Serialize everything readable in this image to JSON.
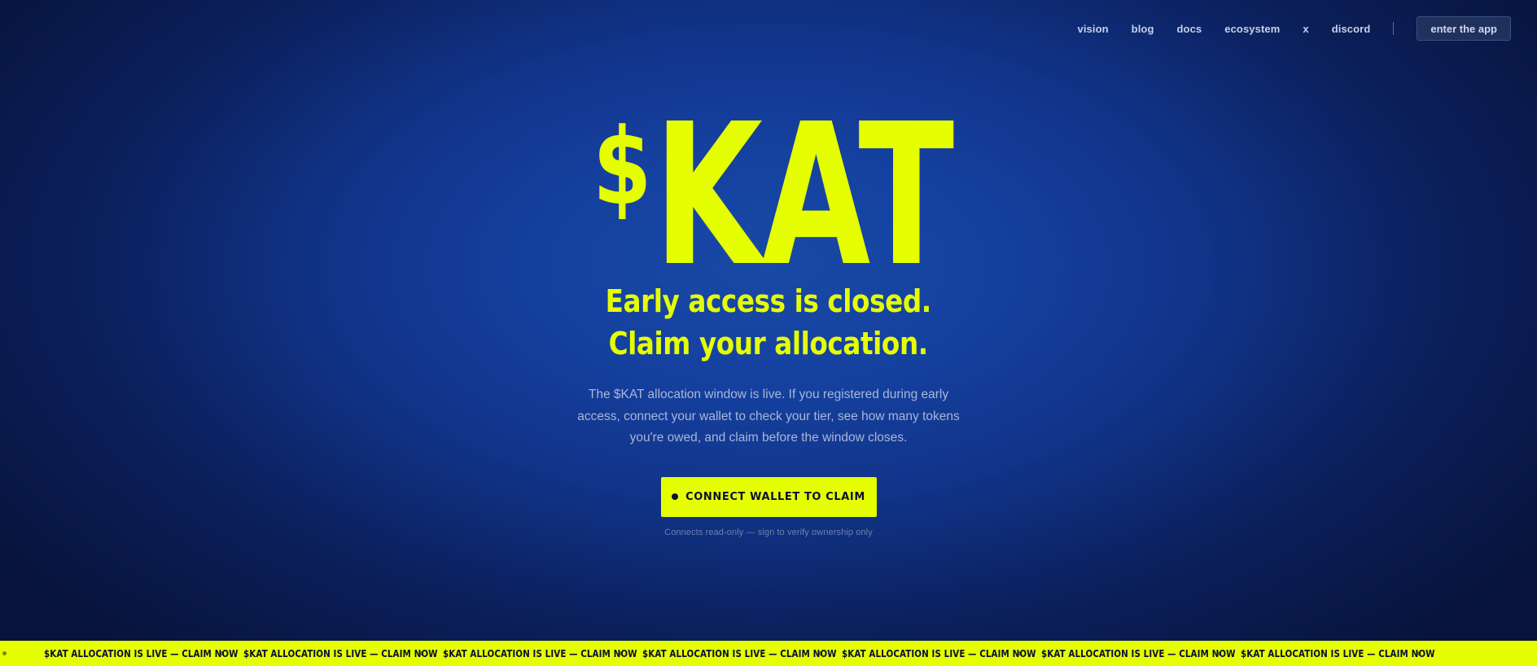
{
  "nav": {
    "links": [
      {
        "label": "vision"
      },
      {
        "label": "blog"
      },
      {
        "label": "docs"
      },
      {
        "label": "ecosystem"
      },
      {
        "label": "x"
      },
      {
        "label": "discord"
      }
    ],
    "enter_app_label": "enter the app"
  },
  "hero": {
    "logo_dollar": "$",
    "logo_word": "KAT",
    "headline_line1": "Early access is closed.",
    "headline_line2": "Claim your allocation.",
    "description": "The $KAT allocation window is live. If you registered during early access, connect your wallet to check your tier, see how many tokens you're owed, and claim before the window closes.",
    "cta_label": "CONNECT WALLET TO CLAIM",
    "cta_note": "Connects read-only — sign to verify ownership only"
  },
  "ticker": {
    "items": [
      "$KAT ALLOCATION IS LIVE — CLAIM NOW",
      "$KAT ALLOCATION IS LIVE — CLAIM NOW",
      "$KAT ALLOCATION IS LIVE — CLAIM NOW",
      "$KAT ALLOCATION IS LIVE — CLAIM NOW",
      "$KAT ALLOCATION IS LIVE — CLAIM NOW",
      "$KAT ALLOCATION IS LIVE — CLAIM NOW",
      "$KAT ALLOCATION IS LIVE — CLAIM NOW"
    ]
  },
  "colors": {
    "accent": "#e6ff00",
    "background_center": "#1849a6",
    "background_edge": "#07133a",
    "text_muted": "#aab6d6"
  }
}
